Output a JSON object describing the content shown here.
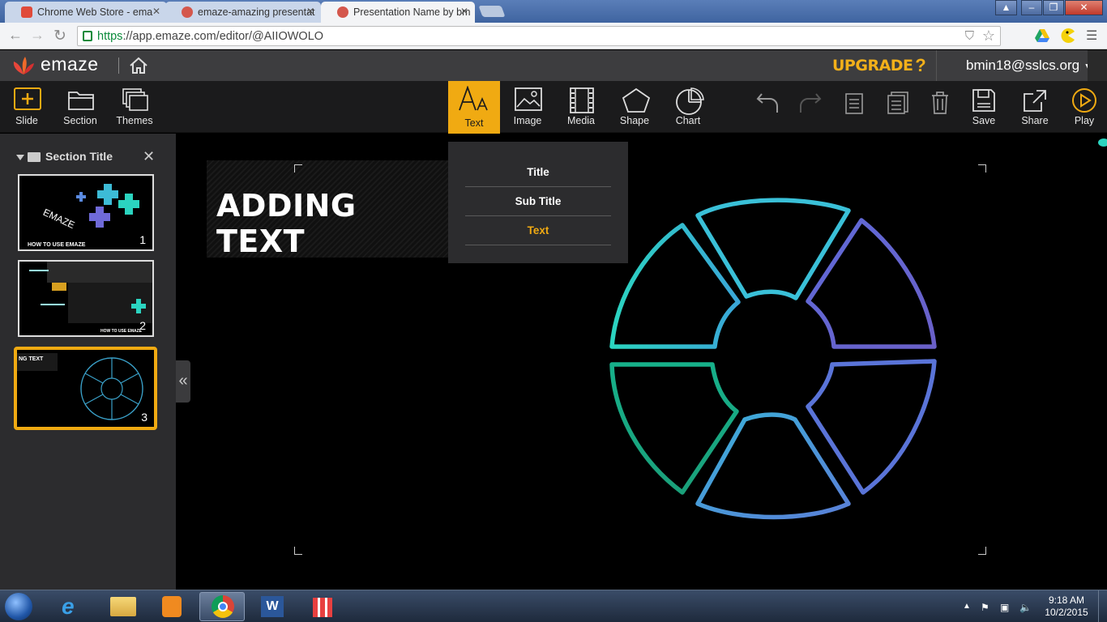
{
  "browser": {
    "tabs": [
      {
        "label": "Chrome Web Store - ema",
        "color": "#e04a3a"
      },
      {
        "label": "emaze-amazing presentat",
        "color": "#d4574c"
      },
      {
        "label": "Presentation Name by bm",
        "color": "#d4574c"
      }
    ],
    "url_scheme": "https",
    "url_rest": "://app.emaze.com/editor/@AIIOWOLO"
  },
  "app": {
    "name": "emaze",
    "upgrade": "UPGRADE",
    "help": "?",
    "user": "bmin18@sslcs.org"
  },
  "toolbar": {
    "left": [
      {
        "label": "Slide",
        "icon": "add-slide-icon"
      },
      {
        "label": "Section",
        "icon": "folder-icon"
      },
      {
        "label": "Themes",
        "icon": "themes-icon"
      }
    ],
    "insert": [
      {
        "label": "Text",
        "icon": "text-icon",
        "active": true
      },
      {
        "label": "Image",
        "icon": "image-icon"
      },
      {
        "label": "Media",
        "icon": "media-icon"
      },
      {
        "label": "Shape",
        "icon": "shape-icon"
      },
      {
        "label": "Chart",
        "icon": "chart-icon"
      }
    ],
    "right": [
      {
        "label": "Save",
        "icon": "save-icon"
      },
      {
        "label": "Share",
        "icon": "share-icon"
      },
      {
        "label": "Play",
        "icon": "play-icon"
      }
    ]
  },
  "text_menu": {
    "items": [
      "Title",
      "Sub Title",
      "Text"
    ],
    "selected": "Text"
  },
  "sidebar": {
    "section_title": "Section Title",
    "slides": [
      {
        "number": "1",
        "caption": "HOW TO USE EMAZE",
        "word": "EMAZE"
      },
      {
        "number": "2",
        "caption": "HOW TO USE EMAZE"
      },
      {
        "number": "3",
        "caption": "NG TEXT"
      }
    ],
    "collapse": "«"
  },
  "slide": {
    "title": "ADDING TEXT"
  },
  "colors": {
    "accent": "#f0aa12",
    "teal": "#2bd4c0",
    "purple": "#5f5bd0"
  },
  "taskbar": {
    "time": "9:18 AM",
    "date": "10/2/2015"
  }
}
